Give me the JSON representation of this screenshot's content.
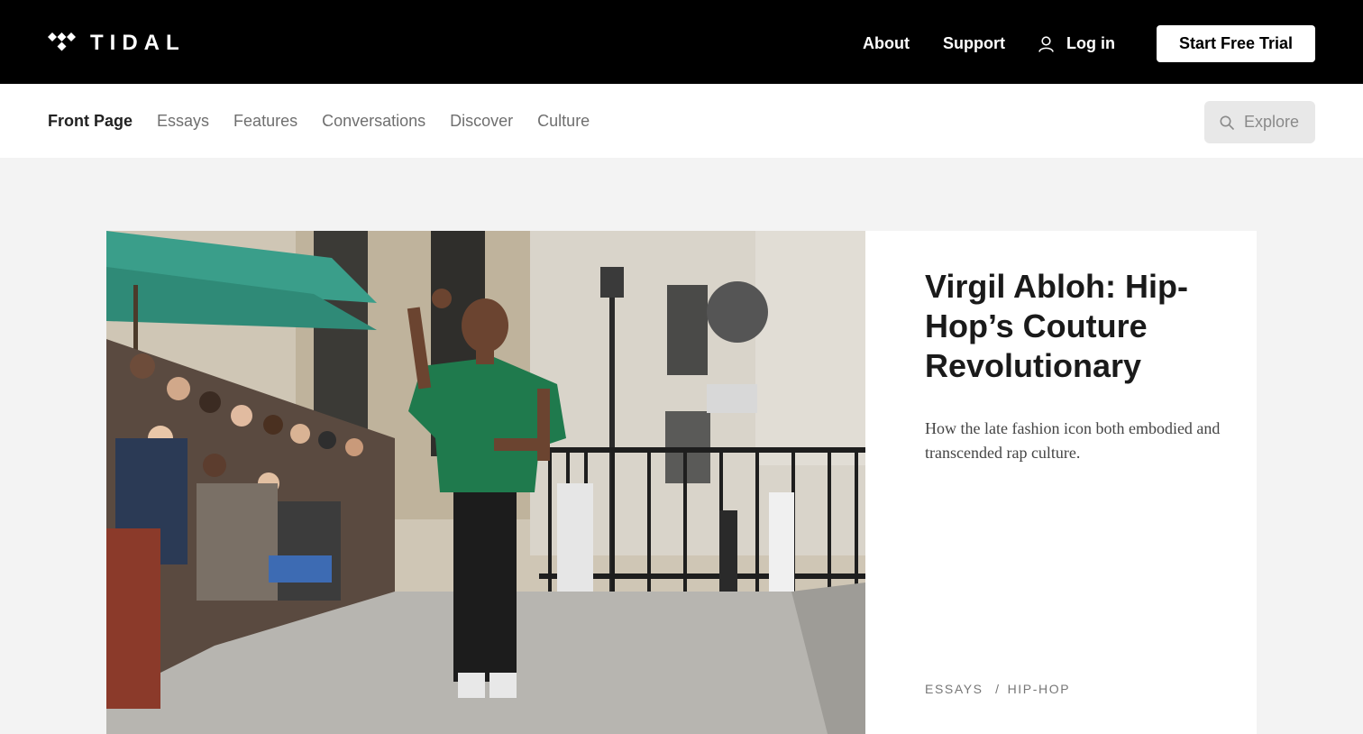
{
  "header": {
    "logo_text": "TIDAL",
    "nav": {
      "about": "About",
      "support": "Support",
      "login": "Log in",
      "trial_button": "Start Free Trial"
    }
  },
  "subnav": {
    "items": [
      {
        "label": "Front Page",
        "active": true
      },
      {
        "label": "Essays"
      },
      {
        "label": "Features"
      },
      {
        "label": "Conversations"
      },
      {
        "label": "Discover"
      },
      {
        "label": "Culture"
      }
    ],
    "search_placeholder": "Explore"
  },
  "feature": {
    "headline": "Virgil Abloh: Hip-Hop’s Couture Revolutionary",
    "dek": "How the late fashion icon both embodied and transcended rap culture.",
    "category": "ESSAYS",
    "separator": "/",
    "tag": "HIP-HOP",
    "image": "runway-photo"
  },
  "colors": {
    "topbar": "#000000",
    "page_bg": "#f3f3f3",
    "shirt_green": "#1f7a4d",
    "umbrella_teal": "#3a9e8a"
  }
}
